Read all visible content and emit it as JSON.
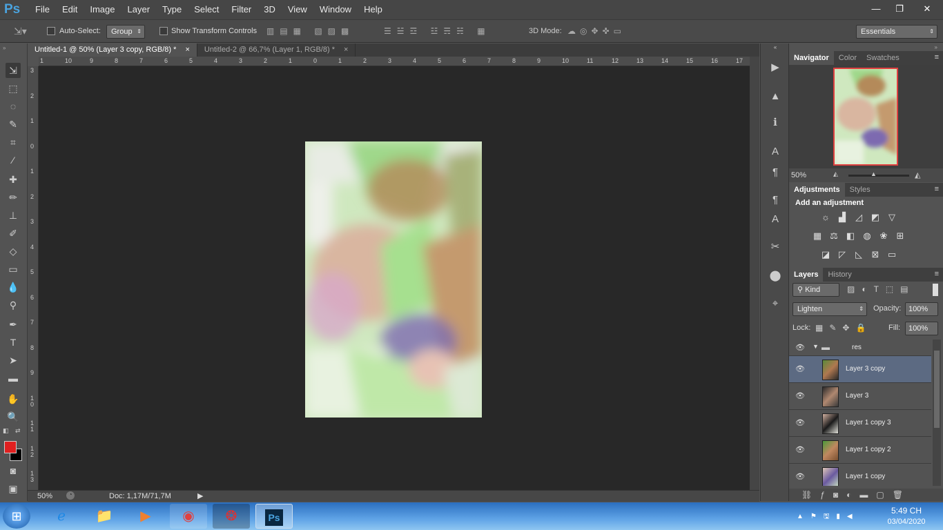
{
  "app": {
    "logo": "Ps"
  },
  "menu": [
    "File",
    "Edit",
    "Image",
    "Layer",
    "Type",
    "Select",
    "Filter",
    "3D",
    "View",
    "Window",
    "Help"
  ],
  "window_controls": {
    "minimize": "—",
    "restore": "❐",
    "close": "✕"
  },
  "options_bar": {
    "auto_select_label": "Auto-Select:",
    "auto_select_value": "Group",
    "show_transform_label": "Show Transform Controls",
    "mode_3d_label": "3D Mode:",
    "workspace_value": "Essentials"
  },
  "tabs": [
    {
      "label": "Untitled-1 @ 50% (Layer 3 copy, RGB/8) *",
      "close": "×"
    },
    {
      "label": "Untitled-2 @ 66,7% (Layer 1, RGB/8) *",
      "close": "×"
    }
  ],
  "ruler_top": [
    "1",
    "10",
    "9",
    "8",
    "7",
    "6",
    "5",
    "4",
    "3",
    "2",
    "1",
    "0",
    "1",
    "2",
    "3",
    "4",
    "5",
    "6",
    "7",
    "8",
    "9",
    "10",
    "11",
    "12",
    "13",
    "14",
    "15",
    "16",
    "17"
  ],
  "ruler_left": [
    "3",
    "2",
    "1",
    "0",
    "1",
    "2",
    "3",
    "4",
    "5",
    "6",
    "7",
    "8",
    "9",
    "1 0",
    "1 1",
    "1 2",
    "1 3"
  ],
  "status": {
    "zoom": "50%",
    "doc": "Doc: 1,17M/71,7M"
  },
  "navigator": {
    "tabs": [
      "Navigator",
      "Color",
      "Swatches"
    ],
    "zoom": "50%"
  },
  "adjustments": {
    "tabs": [
      "Adjustments",
      "Styles"
    ],
    "heading": "Add an adjustment"
  },
  "layers": {
    "tabs": [
      "Layers",
      "History"
    ],
    "kind": "Kind",
    "blend_mode": "Lighten",
    "opacity_label": "Opacity:",
    "opacity": "100%",
    "lock_label": "Lock:",
    "fill_label": "Fill:",
    "fill": "100%",
    "group_name": "res",
    "items": [
      {
        "name": "Layer 3 copy"
      },
      {
        "name": "Layer 3"
      },
      {
        "name": "Layer 1 copy 3"
      },
      {
        "name": "Layer 1 copy 2"
      },
      {
        "name": "Layer 1 copy"
      }
    ]
  },
  "taskbar": {
    "time": "5:49 CH",
    "date": "03/04/2020"
  },
  "colors": {
    "foreground": "#e02020",
    "background": "#000000",
    "accent": "#5c6a82"
  }
}
